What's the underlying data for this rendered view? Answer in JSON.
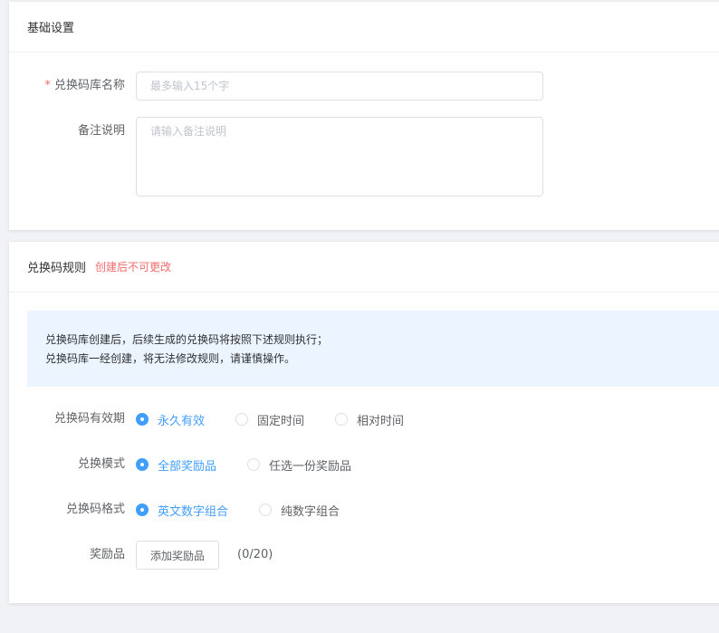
{
  "basic": {
    "title": "基础设置",
    "name_label": "兑换码库名称",
    "name_required_mark": "*",
    "name_placeholder": "最多输入15个字",
    "remark_label": "备注说明",
    "remark_placeholder": "请输入备注说明"
  },
  "rules": {
    "title": "兑换码规则",
    "warning": "创建后不可更改",
    "notice_line1": "兑换码库创建后，后续生成的兑换码将按照下述规则执行；",
    "notice_line2": "兑换码库一经创建，将无法修改规则，请谨慎操作。",
    "validity_label": "兑换码有效期",
    "validity_options": [
      "永久有效",
      "固定时间",
      "相对时间"
    ],
    "validity_selected": "永久有效",
    "mode_label": "兑换模式",
    "mode_options": [
      "全部奖励品",
      "任选一份奖励品"
    ],
    "mode_selected": "全部奖励品",
    "format_label": "兑换码格式",
    "format_options": [
      "英文数字组合",
      "纯数字组合"
    ],
    "format_selected": "英文数字组合",
    "reward_label": "奖励品",
    "add_reward_button": "添加奖励品",
    "reward_count": "(0/20)"
  },
  "colors": {
    "primary": "#409eff",
    "danger": "#f56c6c",
    "notice_bg": "#ecf5ff"
  }
}
